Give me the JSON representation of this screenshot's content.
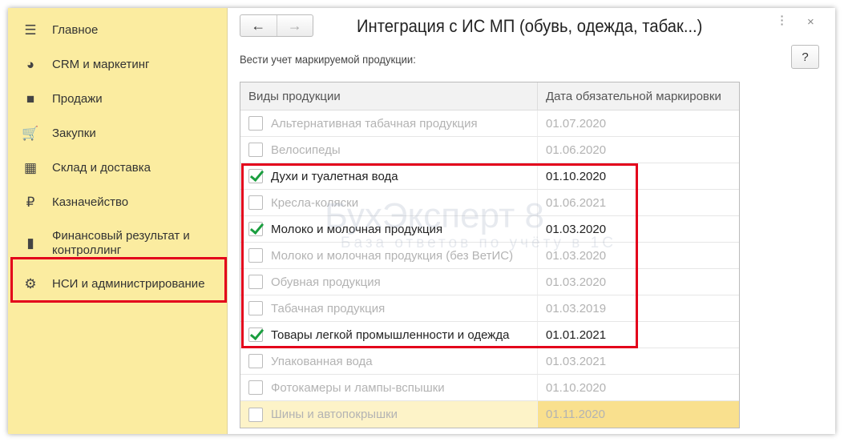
{
  "sidebar": {
    "items": [
      {
        "label": "Главное",
        "icon": "menu-icon"
      },
      {
        "label": "CRM и маркетинг",
        "icon": "pie-chart-icon"
      },
      {
        "label": "Продажи",
        "icon": "shopping-bag-icon"
      },
      {
        "label": "Закупки",
        "icon": "cart-icon"
      },
      {
        "label": "Склад и доставка",
        "icon": "warehouse-icon"
      },
      {
        "label": "Казначейство",
        "icon": "ruble-icon"
      },
      {
        "label": "Финансовый результат и контроллинг",
        "icon": "bar-chart-icon"
      },
      {
        "label": "НСИ и администрирование",
        "icon": "gear-icon"
      }
    ]
  },
  "header": {
    "title": "Интеграция с ИС МП (обувь, одежда, табак...)",
    "back": "←",
    "forward": "→",
    "more": "⋮",
    "close": "×",
    "help": "?"
  },
  "form": {
    "label": "Вести учет маркируемой продукции:"
  },
  "table": {
    "columns": [
      "Виды продукции",
      "Дата обязательной маркировки"
    ],
    "rows": [
      {
        "name": "Альтернативная табачная продукция",
        "date": "01.07.2020",
        "checked": false
      },
      {
        "name": "Велосипеды",
        "date": "01.06.2020",
        "checked": false
      },
      {
        "name": "Духи и туалетная вода",
        "date": "01.10.2020",
        "checked": true
      },
      {
        "name": "Кресла-коляски",
        "date": "01.06.2021",
        "checked": false
      },
      {
        "name": "Молоко и молочная продукция",
        "date": "01.03.2020",
        "checked": true
      },
      {
        "name": "Молоко и молочная продукция (без ВетИС)",
        "date": "01.03.2020",
        "checked": false
      },
      {
        "name": "Обувная продукция",
        "date": "01.03.2020",
        "checked": false
      },
      {
        "name": "Табачная продукция",
        "date": "01.03.2019",
        "checked": false
      },
      {
        "name": "Товары легкой промышленности и одежда",
        "date": "01.01.2021",
        "checked": true
      },
      {
        "name": "Упакованная вода",
        "date": "01.03.2021",
        "checked": false
      },
      {
        "name": "Фотокамеры и лампы-вспышки",
        "date": "01.10.2020",
        "checked": false
      },
      {
        "name": "Шины и автопокрышки",
        "date": "01.11.2020",
        "checked": false,
        "selected": true
      }
    ]
  },
  "watermark": {
    "title": "БухЭксперт 8",
    "subtitle": "База ответов по учёту в 1С"
  },
  "colors": {
    "sidebar": "#fbeca0",
    "highlight": "#e3001b",
    "check": "#1a9e3f",
    "selected_row": "#fdf3c8"
  }
}
